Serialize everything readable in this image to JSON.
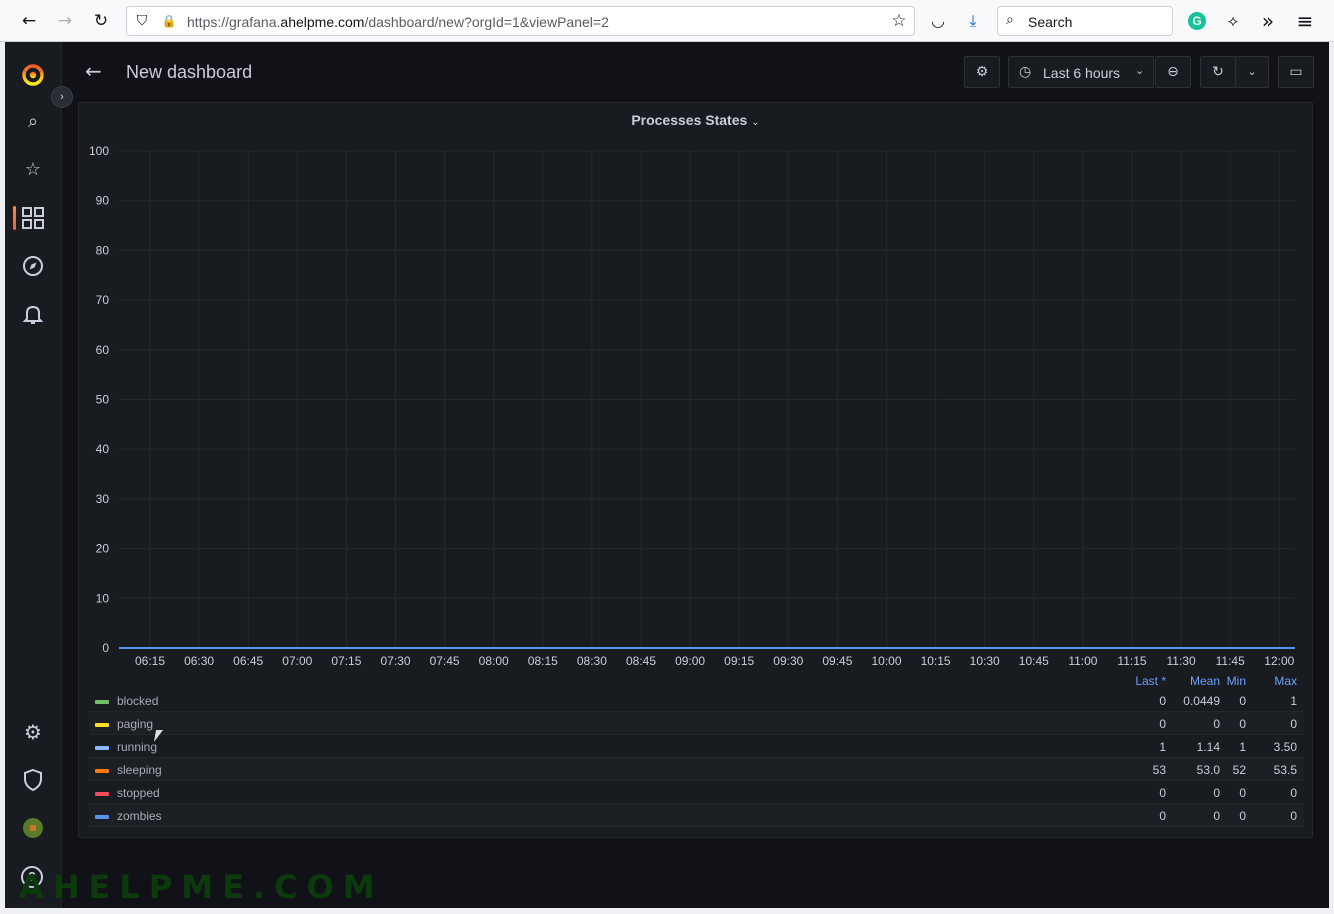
{
  "browser": {
    "url_prefix": "https://grafana.",
    "url_host": "ahelpme.com",
    "url_path": "/dashboard/new?orgId=1&viewPanel=2",
    "search_placeholder": "Search",
    "back_icon": "←",
    "forward_icon": "→",
    "reload_icon": "↻",
    "shield_icon": "⛉",
    "lock_icon": "🔒",
    "star_icon": "☆",
    "pocket_icon": "◡",
    "download_icon": "⤓",
    "search_icon": "⌕",
    "grammarly_label": "G",
    "extension_icon": "⟡",
    "overflow_icon": "»",
    "menu_icon": "≡"
  },
  "sidebar": {
    "items": [
      {
        "name": "search-icon",
        "glyph": "⌕"
      },
      {
        "name": "starred-icon",
        "glyph": "☆"
      },
      {
        "name": "dashboards-icon",
        "glyph": "▦"
      },
      {
        "name": "explore-icon",
        "glyph": "⊘"
      },
      {
        "name": "alerting-icon",
        "glyph": "🔔"
      }
    ],
    "bottom": [
      {
        "name": "configuration-icon",
        "glyph": "⚙"
      },
      {
        "name": "server-admin-icon",
        "glyph": "⛨"
      }
    ],
    "help_label": "?",
    "expand_icon": "›"
  },
  "topnav": {
    "back_icon": "←",
    "title": "New dashboard",
    "settings_icon": "⚙",
    "time_range": "Last 6 hours",
    "clock_icon": "◷",
    "time_chevron": "⌄",
    "zoom_out_icon": "⊖",
    "refresh_icon": "↻",
    "refresh_chevron": "⌄",
    "tv_icon": "▭"
  },
  "panel": {
    "title": "Processes States",
    "title_chevron": "⌄"
  },
  "chart_data": {
    "type": "line",
    "title": "Processes States",
    "xlabel": "",
    "ylabel": "",
    "ylim": [
      0,
      100
    ],
    "y_ticks": [
      0,
      10,
      20,
      30,
      40,
      50,
      60,
      70,
      80,
      90,
      100
    ],
    "x_ticks": [
      "06:15",
      "06:30",
      "06:45",
      "07:00",
      "07:15",
      "07:30",
      "07:45",
      "08:00",
      "08:15",
      "08:30",
      "08:45",
      "09:00",
      "09:15",
      "09:30",
      "09:45",
      "10:00",
      "10:15",
      "10:30",
      "10:45",
      "11:00",
      "11:15",
      "11:30",
      "11:45",
      "12:00"
    ],
    "grid": true,
    "legend_placement": "bottom",
    "legend_columns": [
      "Last *",
      "Mean",
      "Min",
      "Max"
    ],
    "series": [
      {
        "name": "blocked",
        "color": "#73bf69",
        "values": [
          "0",
          "0.0449",
          "0",
          "1"
        ],
        "line": 0
      },
      {
        "name": "paging",
        "color": "#fade2a",
        "values": [
          "0",
          "0",
          "0",
          "0"
        ],
        "line": 0
      },
      {
        "name": "running",
        "color": "#8ab8ff",
        "values": [
          "1",
          "1.14",
          "1",
          "3.50"
        ],
        "line": 0
      },
      {
        "name": "sleeping",
        "color": "#ff780a",
        "values": [
          "53",
          "53.0",
          "52",
          "53.5"
        ],
        "line": 0
      },
      {
        "name": "stopped",
        "color": "#f2495c",
        "values": [
          "0",
          "0",
          "0",
          "0"
        ],
        "line": 0
      },
      {
        "name": "zombies",
        "color": "#5794f2",
        "values": [
          "0",
          "0",
          "0",
          "0"
        ],
        "line": 0
      }
    ]
  },
  "watermark": "AHELPME.COM"
}
